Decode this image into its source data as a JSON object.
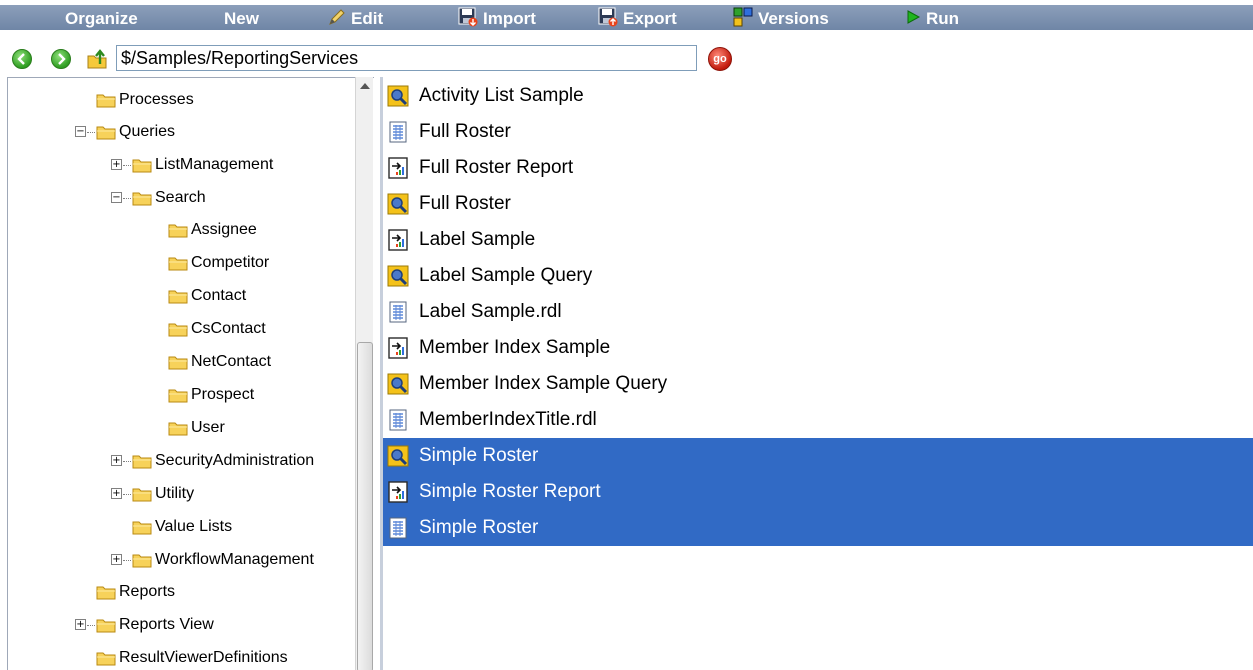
{
  "toolbar": {
    "items": [
      {
        "label": "Organize",
        "icon": "none"
      },
      {
        "label": "New",
        "icon": "none"
      },
      {
        "label": "Edit",
        "icon": "pencil-icon"
      },
      {
        "label": "Import",
        "icon": "import-icon"
      },
      {
        "label": "Export",
        "icon": "export-icon"
      },
      {
        "label": "Versions",
        "icon": "versions-icon"
      },
      {
        "label": "Run",
        "icon": "run-icon"
      }
    ],
    "text_color": "#ffffff",
    "bg_color": "#7a8fae"
  },
  "address": {
    "path": "$/Samples/ReportingServices",
    "go_label": "go"
  },
  "tree": {
    "items": [
      {
        "label": "Processes"
      },
      {
        "label": "Queries"
      },
      {
        "label": "ListManagement"
      },
      {
        "label": "Search"
      },
      {
        "label": "Assignee"
      },
      {
        "label": "Competitor"
      },
      {
        "label": "Contact"
      },
      {
        "label": "CsContact"
      },
      {
        "label": "NetContact"
      },
      {
        "label": "Prospect"
      },
      {
        "label": "User"
      },
      {
        "label": "SecurityAdministration"
      },
      {
        "label": "Utility"
      },
      {
        "label": "Value Lists"
      },
      {
        "label": "WorkflowManagement"
      },
      {
        "label": "Reports"
      },
      {
        "label": "Reports View"
      },
      {
        "label": "ResultViewerDefinitions"
      }
    ]
  },
  "list": {
    "selected_color": "#316ac5",
    "items": [
      {
        "label": "Activity List Sample",
        "icon": "query-icon",
        "selected": false
      },
      {
        "label": "Full Roster",
        "icon": "rdl-icon",
        "selected": false
      },
      {
        "label": "Full Roster Report",
        "icon": "report-icon",
        "selected": false
      },
      {
        "label": "Full Roster",
        "icon": "query-icon",
        "selected": false
      },
      {
        "label": "Label Sample",
        "icon": "report-icon",
        "selected": false
      },
      {
        "label": "Label Sample Query",
        "icon": "query-icon",
        "selected": false
      },
      {
        "label": "Label Sample.rdl",
        "icon": "rdl-icon",
        "selected": false
      },
      {
        "label": "Member Index Sample",
        "icon": "report-icon",
        "selected": false
      },
      {
        "label": "Member Index Sample Query",
        "icon": "query-icon",
        "selected": false
      },
      {
        "label": "MemberIndexTitle.rdl",
        "icon": "rdl-icon",
        "selected": false
      },
      {
        "label": "Simple Roster",
        "icon": "query-icon",
        "selected": true
      },
      {
        "label": "Simple Roster Report",
        "icon": "report-icon",
        "selected": true
      },
      {
        "label": "Simple Roster",
        "icon": "rdl-icon",
        "selected": true
      }
    ]
  }
}
